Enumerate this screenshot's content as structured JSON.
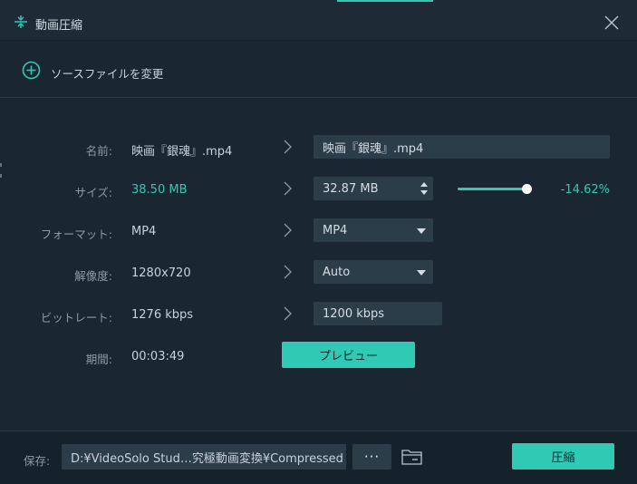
{
  "window": {
    "title": "動画圧縮",
    "icon": "compress-icon",
    "close_icon": "close-icon"
  },
  "source": {
    "change_label": "ソースファイルを変更",
    "icon": "plus-circle-icon"
  },
  "fields": {
    "name": {
      "label": "名前:",
      "original": "映画『銀魂』.mp4",
      "output": "映画『銀魂』.mp4"
    },
    "size": {
      "label": "サイズ:",
      "original": "38.50 MB",
      "output": "32.87 MB",
      "percent": "-14.62%",
      "slider_level": 0.9
    },
    "format": {
      "label": "フォーマット:",
      "original": "MP4",
      "output": "MP4"
    },
    "resolution": {
      "label": "解像度:",
      "original": "1280x720",
      "output": "Auto"
    },
    "bitrate": {
      "label": "ビットレート:",
      "original": "1276 kbps",
      "output": "1200 kbps"
    },
    "duration": {
      "label": "期間:",
      "original": "00:03:49"
    }
  },
  "preview_label": "プレビュー",
  "footer": {
    "save_label": "保存:",
    "path": "D:¥VideoSolo Stud…究極動画変換¥Compressed",
    "more_label": "···",
    "compress_label": "圧縮"
  },
  "colors": {
    "accent": "#2fc9b4",
    "background": "#1a2733",
    "field": "#2c3d4a"
  }
}
